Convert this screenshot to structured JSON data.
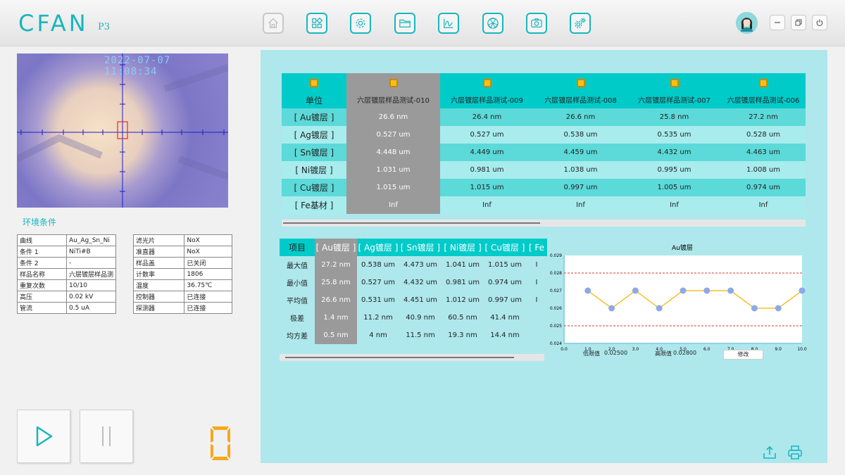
{
  "app": {
    "logo": "CFAN",
    "logo_sub": "P3"
  },
  "nav": {
    "buttons": [
      {
        "icon": "home-icon",
        "enabled": false
      },
      {
        "icon": "apps-grid-icon",
        "enabled": true
      },
      {
        "icon": "settings-gear-icon",
        "enabled": true
      },
      {
        "icon": "folder-icon",
        "enabled": true
      },
      {
        "icon": "chart-line-icon",
        "enabled": true
      },
      {
        "icon": "radiation-icon",
        "enabled": true
      },
      {
        "icon": "camera-icon",
        "enabled": true
      },
      {
        "icon": "gears-icon",
        "enabled": true
      }
    ]
  },
  "camera": {
    "timestamp": "2022-07-07 11:08:34"
  },
  "env": {
    "title": "环境条件",
    "left": [
      [
        "曲线",
        "Au_Ag_Sn_Ni"
      ],
      [
        "条件 1",
        "NiTi#B"
      ],
      [
        "条件 2",
        "-"
      ],
      [
        "样品名称",
        "六层镀层样品测"
      ],
      [
        "重复次数",
        "10/10"
      ],
      [
        "高压",
        "0.02 kV"
      ],
      [
        "管流",
        "0.5 uA"
      ]
    ],
    "right": [
      [
        "滤光片",
        "NoX"
      ],
      [
        "准直器",
        "NoX"
      ],
      [
        "样品盖",
        "已关闭"
      ],
      [
        "计数率",
        "1806"
      ],
      [
        "温度",
        "36.75℃"
      ],
      [
        "控制器",
        "已连接"
      ],
      [
        "探测器",
        "已连接"
      ]
    ]
  },
  "controls": {
    "counter_display": "0"
  },
  "results": {
    "unit_label": "单位",
    "samples": [
      "六层镀层样品测试-010",
      "六层镀层样品测试-009",
      "六层镀层样品测试-008",
      "六层镀层样品测试-007",
      "六层镀层样品测试-006"
    ],
    "rows": [
      {
        "label": "[ Au镀层 ]",
        "values": [
          "26.6 nm",
          "26.4 nm",
          "26.6 nm",
          "25.8 nm",
          "27.2 nm"
        ]
      },
      {
        "label": "[ Ag镀层 ]",
        "values": [
          "0.527 um",
          "0.527 um",
          "0.538 um",
          "0.535 um",
          "0.528 um"
        ]
      },
      {
        "label": "[ Sn镀层 ]",
        "values": [
          "4.448 um",
          "4.449 um",
          "4.459 um",
          "4.432 um",
          "4.463 um"
        ]
      },
      {
        "label": "[ Ni镀层 ]",
        "values": [
          "1.031 um",
          "0.981 um",
          "1.038 um",
          "0.995 um",
          "1.008 um"
        ]
      },
      {
        "label": "[ Cu镀层 ]",
        "values": [
          "1.015 um",
          "1.015 um",
          "0.997 um",
          "1.005 um",
          "0.974 um"
        ]
      },
      {
        "label": "[ Fe基材 ]",
        "values": [
          "Inf",
          "Inf",
          "Inf",
          "Inf",
          "Inf"
        ]
      }
    ]
  },
  "stats": {
    "headers": [
      "项目",
      "[ Au镀层 ]",
      "[ Ag镀层 ]",
      "[ Sn镀层 ]",
      "[ Ni镀层 ]",
      "[ Cu镀层 ]",
      "[ Fe"
    ],
    "rows": [
      {
        "label": "最大值",
        "values": [
          "27.2 nm",
          "0.538 um",
          "4.473 um",
          "1.041 um",
          "1.015 um",
          "I"
        ]
      },
      {
        "label": "最小值",
        "values": [
          "25.8 nm",
          "0.527 um",
          "4.432 um",
          "0.981 um",
          "0.974 um",
          "I"
        ]
      },
      {
        "label": "平均值",
        "values": [
          "26.6 nm",
          "0.531 um",
          "4.451 um",
          "1.012 um",
          "0.997 um",
          "I"
        ]
      },
      {
        "label": "极差",
        "values": [
          "1.4 nm",
          "11.2 nm",
          "40.9 nm",
          "60.5 nm",
          "41.4 nm",
          ""
        ]
      },
      {
        "label": "均方差",
        "values": [
          "0.5 nm",
          "4 nm",
          "11.5 nm",
          "19.3 nm",
          "14.4 nm",
          ""
        ]
      }
    ]
  },
  "chart_data": {
    "type": "line",
    "title": "Au镀层",
    "xlabel": "",
    "ylabel": "",
    "x": [
      1,
      2,
      3,
      4,
      5,
      6,
      7,
      8,
      9,
      10
    ],
    "series": [
      {
        "values": [
          0.027,
          0.026,
          0.027,
          0.026,
          0.027,
          0.027,
          0.027,
          0.026,
          0.026,
          0.027
        ]
      }
    ],
    "xlim": [
      0,
      10
    ],
    "ylim": [
      0.024,
      0.029
    ],
    "xticks": [
      "0.0",
      "1.0",
      "2.0",
      "3.0",
      "4.0",
      "5.0",
      "6.0",
      "7.0",
      "8.0",
      "9.0",
      "10.0"
    ],
    "yticks": [
      "0.024",
      "0.025",
      "0.026",
      "0.027",
      "0.028",
      "0.029"
    ],
    "limits": {
      "low": 0.025,
      "high": 0.028
    },
    "colors": {
      "line": "#f2b400",
      "marker": "#8ea8e8",
      "limit": "#d83a2a"
    }
  },
  "limits_form": {
    "low_label": "低限值",
    "low_value": "0.02500",
    "high_label": "高限值",
    "high_value": "0.02800",
    "modify_label": "修改"
  },
  "colors": {
    "accent": "#19b6be",
    "header": "#00cbc9",
    "panel": "#aee8ec",
    "selected": "#9a9a9a",
    "digit": "#f7a81b"
  }
}
